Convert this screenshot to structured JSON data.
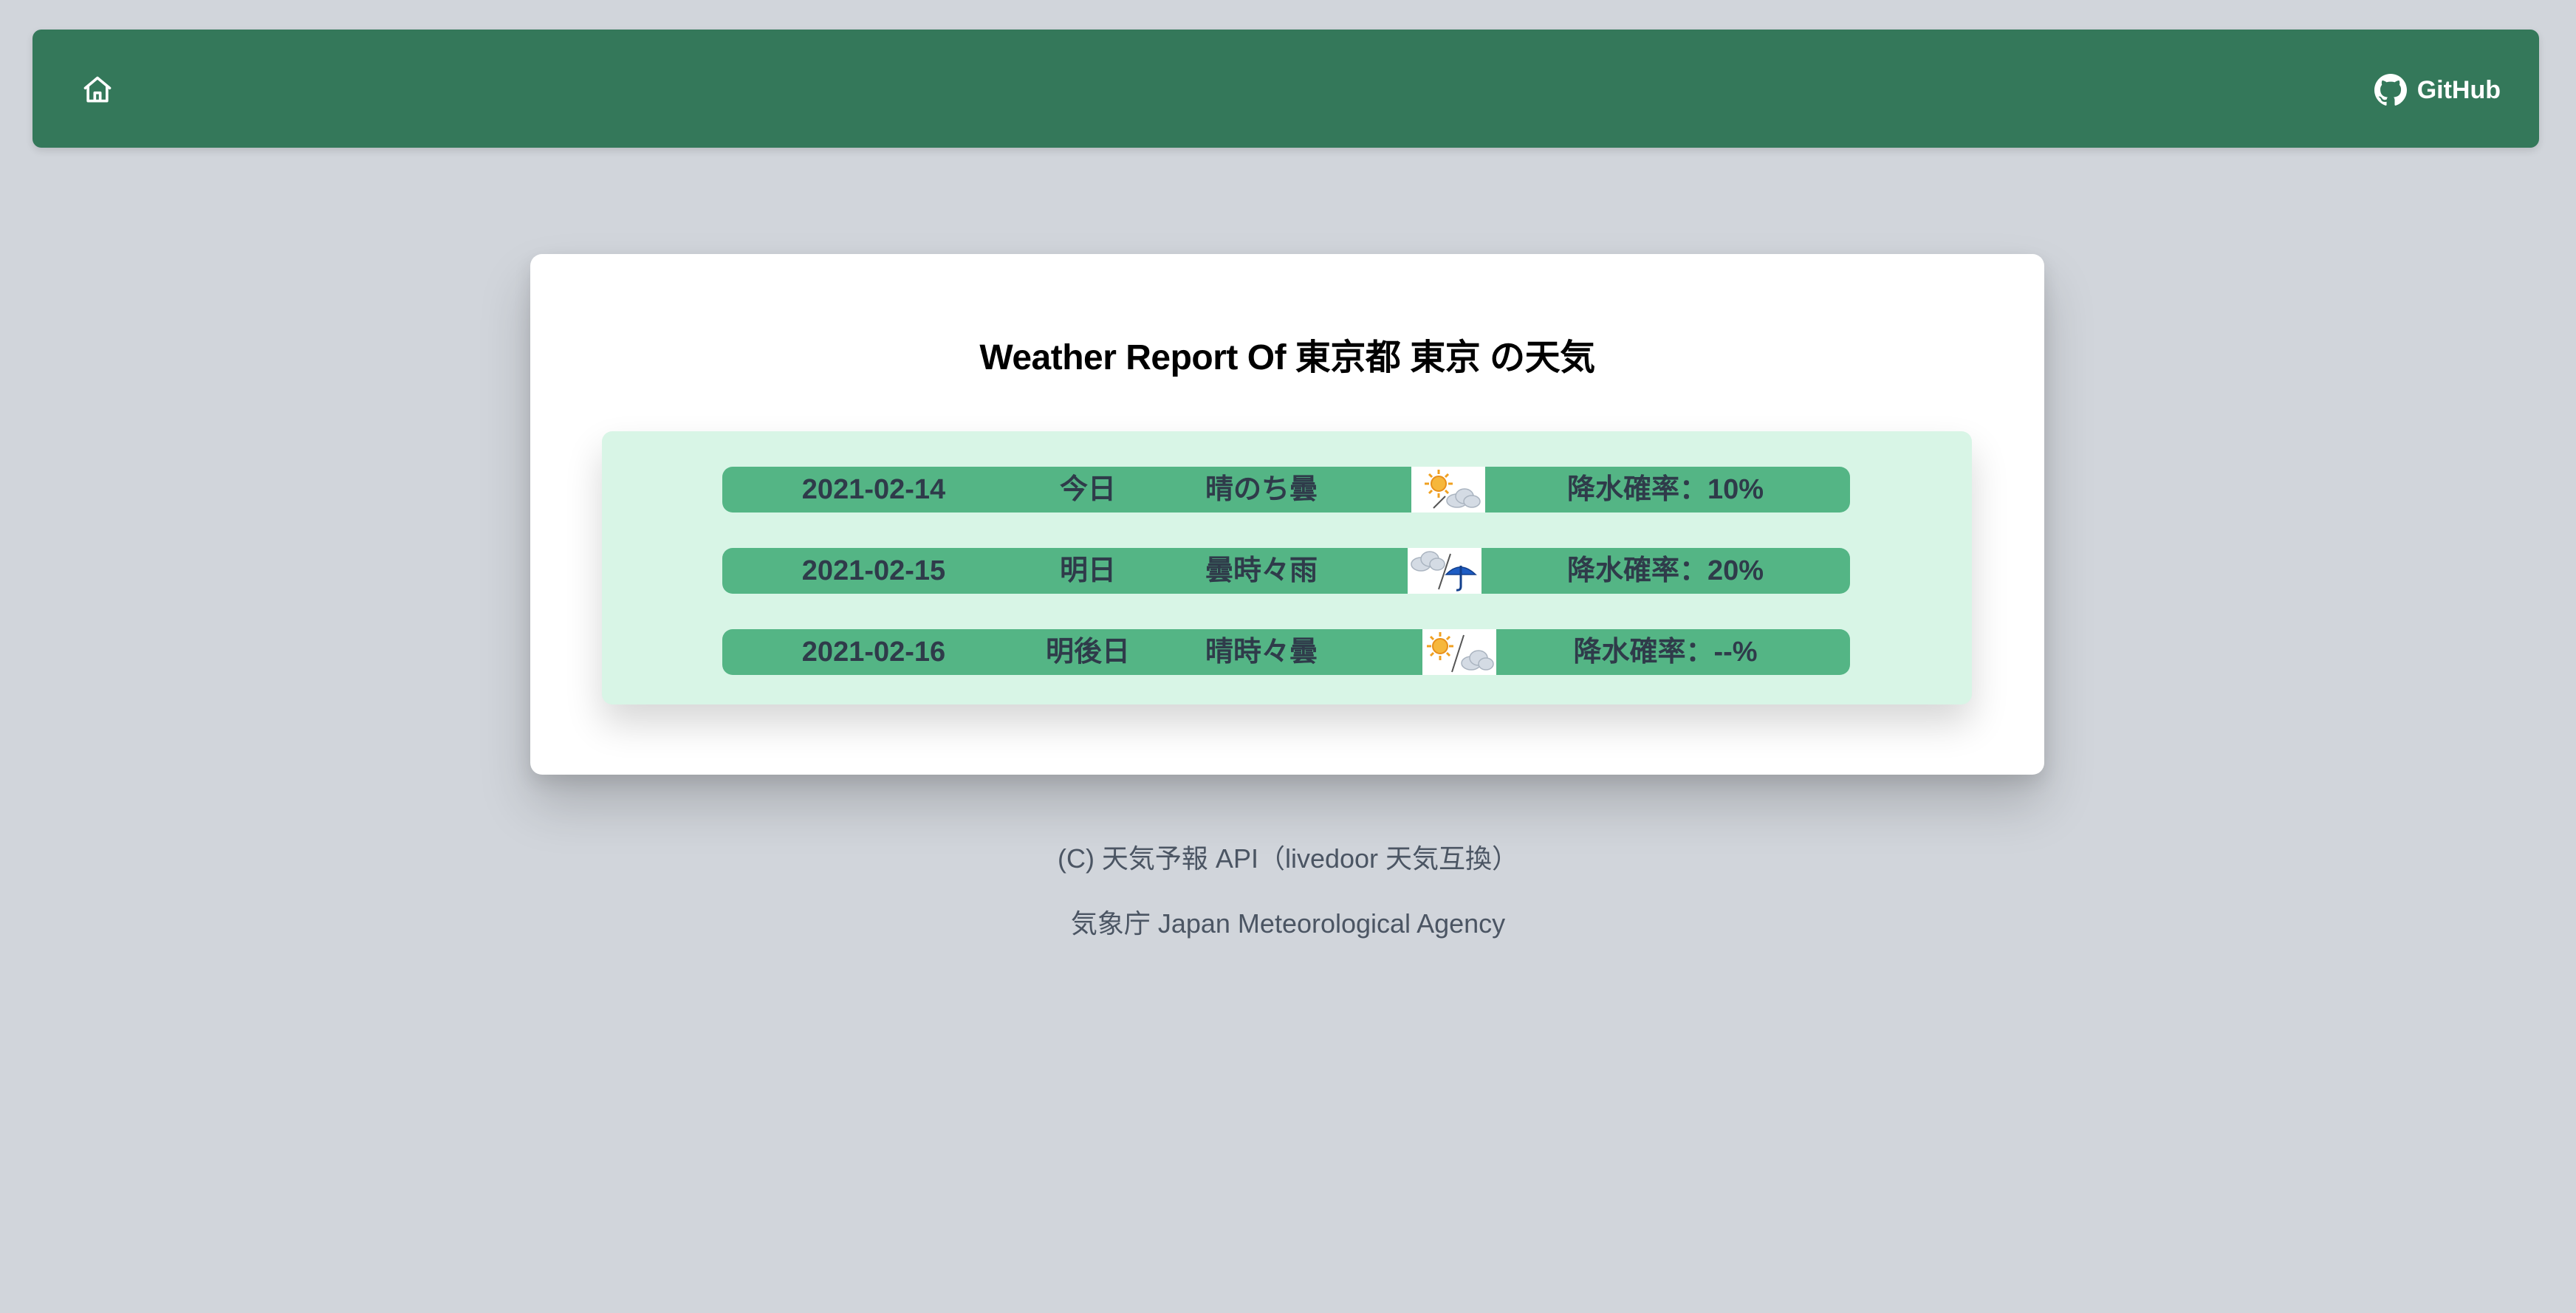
{
  "nav": {
    "home_icon": "home-icon",
    "github_icon": "github-icon",
    "github_label": "GitHub"
  },
  "report": {
    "title": "Weather Report Of 東京都 東京 の天気",
    "forecasts": [
      {
        "date": "2021-02-14",
        "day": "今日",
        "condition": "晴のち曇",
        "icon": "sun-then-cloud-icon",
        "rain": "降水確率：10%"
      },
      {
        "date": "2021-02-15",
        "day": "明日",
        "condition": "曇時々雨",
        "icon": "cloud-sometimes-rain-icon",
        "rain": "降水確率：20%"
      },
      {
        "date": "2021-02-16",
        "day": "明後日",
        "condition": "晴時々曇",
        "icon": "sun-sometimes-cloud-icon",
        "rain": "降水確率：--%"
      }
    ]
  },
  "footer": {
    "line1": "(C) 天気予報 API（livedoor 天気互換）",
    "line2": "気象庁 Japan Meteorological Agency"
  },
  "colors": {
    "background": "#d1d5db",
    "navbar": "#34785a",
    "panel": "#d8f5e6",
    "row": "#54b585",
    "row_text": "#2f3b4a"
  }
}
